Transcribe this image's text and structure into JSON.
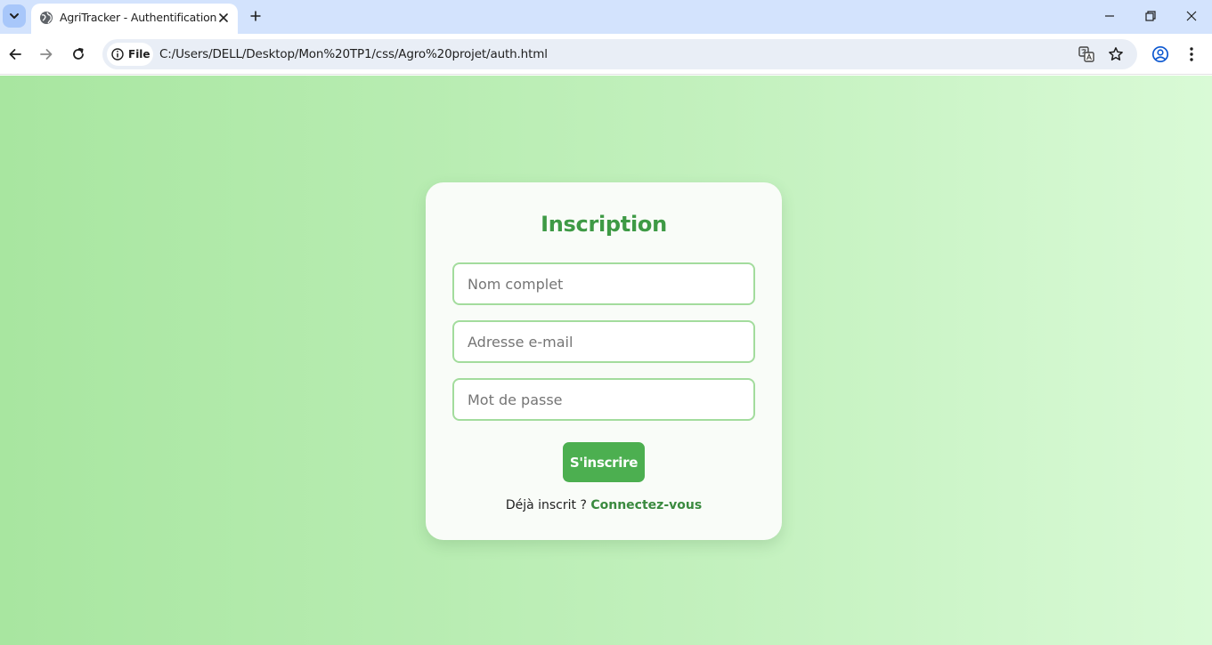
{
  "browser": {
    "tab": {
      "title": "AgriTracker - Authentification"
    },
    "address_bar": {
      "chip_label": "File",
      "url": "C:/Users/DELL/Desktop/Mon%20TP1/css/Agro%20projet/auth.html"
    }
  },
  "form": {
    "title": "Inscription",
    "fields": {
      "name": {
        "placeholder": "Nom complet",
        "value": ""
      },
      "email": {
        "placeholder": "Adresse e-mail",
        "value": ""
      },
      "password": {
        "placeholder": "Mot de passe",
        "value": ""
      }
    },
    "submit_label": "S'inscrire",
    "switch_prompt": "Déjà inscrit ?",
    "switch_link": "Connectez-vous"
  },
  "colors": {
    "accent": "#4caf50",
    "title": "#3e9a45",
    "input_border": "#a3dc9d",
    "background_start": "#a8e6a0",
    "background_end": "#d9fad6"
  }
}
